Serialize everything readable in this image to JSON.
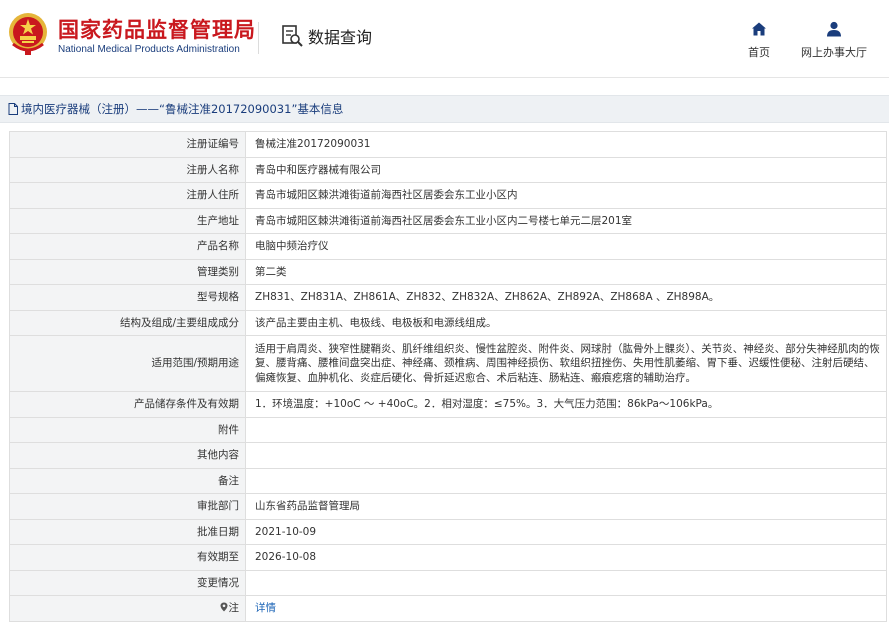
{
  "header": {
    "logo_cn": "国家药品监督管理局",
    "logo_en": "National Medical Products Administration",
    "query_title": "数据查询",
    "nav": [
      {
        "label": "首页",
        "icon": "home-icon"
      },
      {
        "label": "网上办事大厅",
        "icon": "user-icon"
      }
    ]
  },
  "breadcrumb": {
    "text": "境内医疗器械（注册）——“鲁械注准20172090031”基本信息"
  },
  "table": {
    "rows": [
      {
        "label": "注册证编号",
        "value": "鲁械注准20172090031"
      },
      {
        "label": "注册人名称",
        "value": "青岛中和医疗器械有限公司"
      },
      {
        "label": "注册人住所",
        "value": "青岛市城阳区棘洪滩街道前海西社区居委会东工业小区内"
      },
      {
        "label": "生产地址",
        "value": "青岛市城阳区棘洪滩街道前海西社区居委会东工业小区内二号楼七单元二层201室"
      },
      {
        "label": "产品名称",
        "value": "电脑中频治疗仪"
      },
      {
        "label": "管理类别",
        "value": "第二类"
      },
      {
        "label": "型号规格",
        "value": "ZH831、ZH831A、ZH861A、ZH832、ZH832A、ZH862A、ZH892A、ZH868A 、ZH898A。"
      },
      {
        "label": "结构及组成/主要组成成分",
        "value": "该产品主要由主机、电极线、电极板和电源线组成。"
      },
      {
        "label": "适用范围/预期用途",
        "value": "适用于肩周炎、狭窄性腱鞘炎、肌纤维组织炎、慢性盆腔炎、附件炎、网球肘（肱骨外上髁炎）、关节炎、神经炎、部分失神经肌肉的恢复、腰背痛、腰椎间盘突出症、神经痛、颈椎病、周围神经损伤、软组织扭挫伤、失用性肌萎缩、胃下垂、迟缓性便秘、注射后硬结、偏瘫恢复、血肿机化、炎症后硬化、骨折延迟愈合、术后粘连、肠粘连、瘢痕疙瘩的辅助治疗。"
      },
      {
        "label": "产品储存条件及有效期",
        "value": "1．环境温度：+10oC ～ +40oC。2．相对湿度：≤75%。3．大气压力范围：86kPa～106kPa。"
      },
      {
        "label": "附件",
        "value": ""
      },
      {
        "label": "其他内容",
        "value": ""
      },
      {
        "label": "备注",
        "value": ""
      },
      {
        "label": "审批部门",
        "value": "山东省药品监督管理局"
      },
      {
        "label": "批准日期",
        "value": "2021-10-09"
      },
      {
        "label": "有效期至",
        "value": "2026-10-08"
      },
      {
        "label": "变更情况",
        "value": ""
      },
      {
        "label": "注",
        "value": "详情"
      }
    ]
  },
  "colors": {
    "brand_red": "#c9181e",
    "brand_blue": "#1a3d7c",
    "link_blue": "#1d65b7",
    "label_bg": "#f3f4f5"
  }
}
